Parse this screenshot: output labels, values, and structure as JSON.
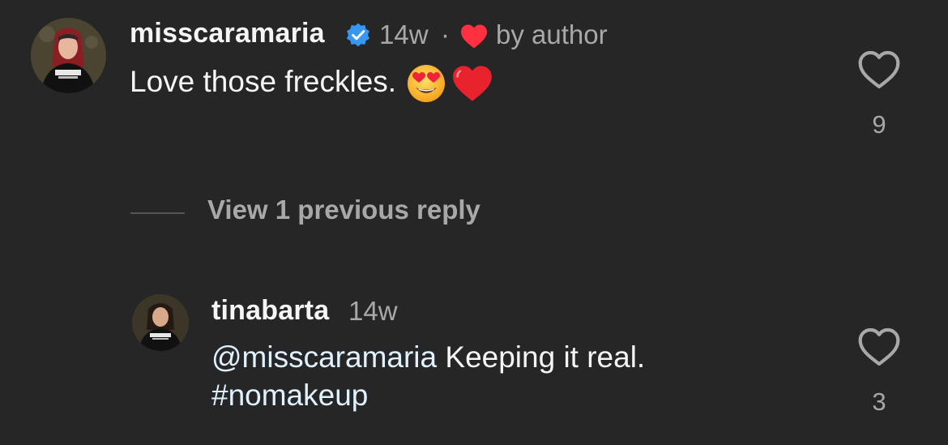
{
  "comments": [
    {
      "username": "misscaramaria",
      "verified": true,
      "time": "14w",
      "separator": "·",
      "liked_by_author_label": "by author",
      "text": "Love those freckles.",
      "emojis": [
        "heart-eyes-face",
        "red-heart"
      ],
      "like_count": "9"
    }
  ],
  "replies_toggle": {
    "label": "View 1 previous reply"
  },
  "replies": [
    {
      "username": "tinabarta",
      "time": "14w",
      "mention": "@misscaramaria",
      "text": " Keeping it real.",
      "hashtag": "#nomakeup",
      "like_count": "3"
    }
  ],
  "colors": {
    "background": "#262626",
    "text_primary": "#f5f5f5",
    "text_secondary": "#a8a8a8",
    "link": "#e0f1ff",
    "verified": "#3897f0",
    "author_heart": "#ff3040"
  }
}
